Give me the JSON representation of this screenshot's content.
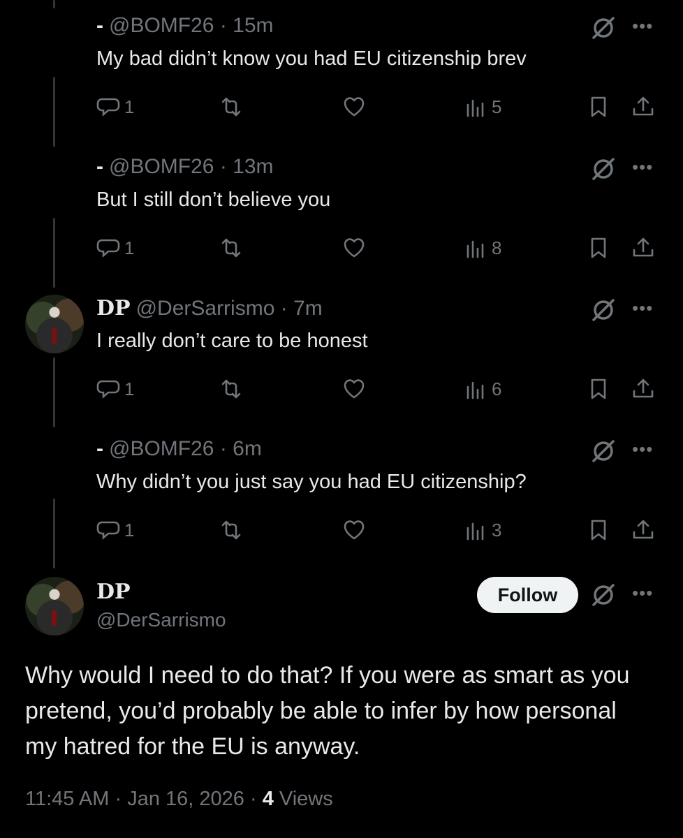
{
  "replies": [
    {
      "display_name": "",
      "prefix": "-",
      "handle": "@BOMF26",
      "sep": "·",
      "time": "15m",
      "text": "My bad didn’t know you had EU citizenship brev",
      "replies": "1",
      "views": "5",
      "has_avatar": false
    },
    {
      "display_name": "",
      "prefix": "-",
      "handle": "@BOMF26",
      "sep": "·",
      "time": "13m",
      "text": "But I still don’t believe you",
      "replies": "1",
      "views": "8",
      "has_avatar": false
    },
    {
      "display_name": "DP",
      "prefix": "",
      "handle": "@DerSarrismo",
      "sep": "·",
      "time": "7m",
      "text": "I really don’t care to be honest",
      "replies": "1",
      "views": "6",
      "has_avatar": true
    },
    {
      "display_name": "",
      "prefix": "-",
      "handle": "@BOMF26",
      "sep": "·",
      "time": "6m",
      "text": "Why didn’t you just say you had EU citizenship?",
      "replies": "1",
      "views": "3",
      "has_avatar": false
    }
  ],
  "main_post": {
    "display_name": "DP",
    "handle": "@DerSarrismo",
    "follow_label": "Follow",
    "text": "Why would I need to do that? If you were as smart as you pretend, you’d probably be able to infer by how personal my hatred for the EU is anyway.",
    "time": "11:45 AM",
    "date": "Jan 16, 2026",
    "views_count": "4",
    "views_label": "Views",
    "sep": "·"
  },
  "more_glyph": "•••",
  "colors": {
    "background": "#000000",
    "text": "#e7e9ea",
    "muted": "#71767b",
    "follow_bg": "#eff3f4"
  }
}
